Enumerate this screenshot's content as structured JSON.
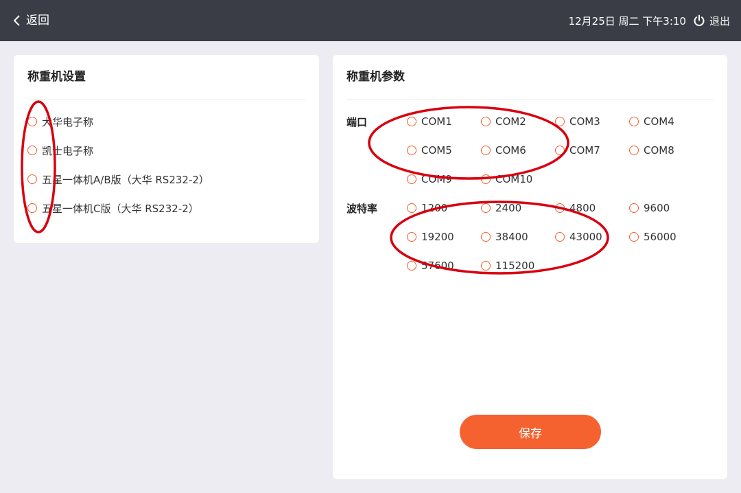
{
  "header": {
    "back_label": "返回",
    "datetime": "12月25日 周二 下午3:10",
    "logout_label": "退出"
  },
  "scale_settings": {
    "title": "称重机设置",
    "options": [
      "大华电子称",
      "凯士电子称",
      "五星一体机A/B版（大华 RS232-2）",
      "五星一体机C版（大华 RS232-2）"
    ]
  },
  "scale_params": {
    "title": "称重机参数",
    "port_label": "端口",
    "ports": [
      "COM1",
      "COM2",
      "COM3",
      "COM4",
      "COM5",
      "COM6",
      "COM7",
      "COM8",
      "COM9",
      "COM10"
    ],
    "baud_label": "波特率",
    "bauds": [
      "1200",
      "2400",
      "4800",
      "9600",
      "19200",
      "38400",
      "43000",
      "56000",
      "57600",
      "115200"
    ],
    "save_label": "保存"
  },
  "colors": {
    "accent": "#f56230",
    "topbar": "#3a3d45",
    "annotation": "#d8000f"
  }
}
